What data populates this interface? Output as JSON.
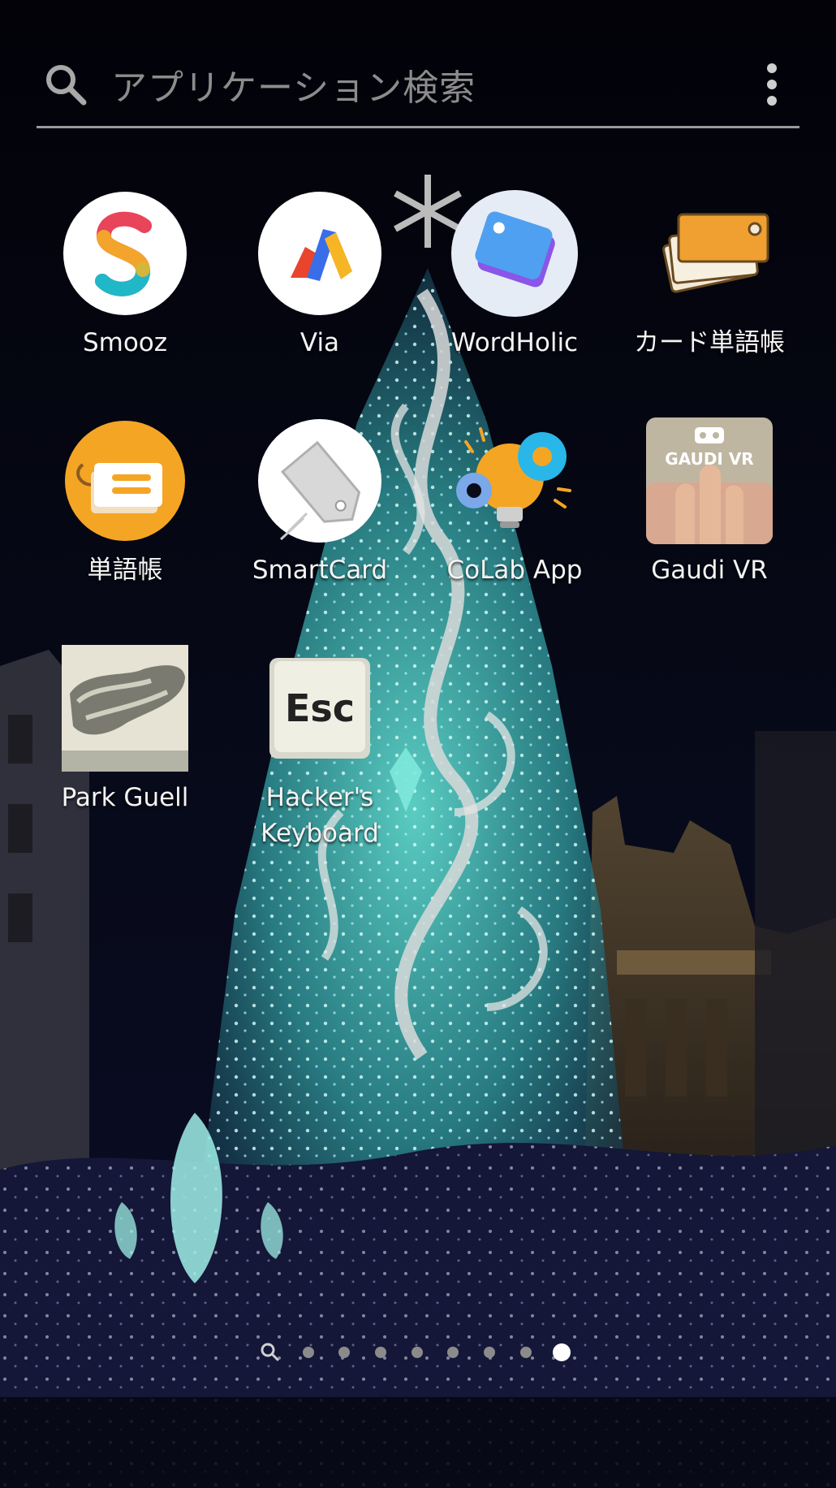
{
  "search": {
    "placeholder": "アプリケーション検索"
  },
  "apps": [
    {
      "label": "Smooz"
    },
    {
      "label": "Via"
    },
    {
      "label": "WordHolic"
    },
    {
      "label": "カード単語帳"
    },
    {
      "label": "単語帳"
    },
    {
      "label": "SmartCard"
    },
    {
      "label": "CoLab App"
    },
    {
      "label": "Gaudi VR",
      "icon_text": "GAUDI VR"
    },
    {
      "label": "Park Guell"
    },
    {
      "label": "Hacker's\nKeyboard",
      "icon_text": "Esc"
    }
  ],
  "page_indicator": {
    "total": 8,
    "active_index": 7,
    "first_is_search": true
  },
  "colors": {
    "accent": "#f5a524",
    "tree": "#3fb7b0",
    "sky": "#05060d"
  }
}
